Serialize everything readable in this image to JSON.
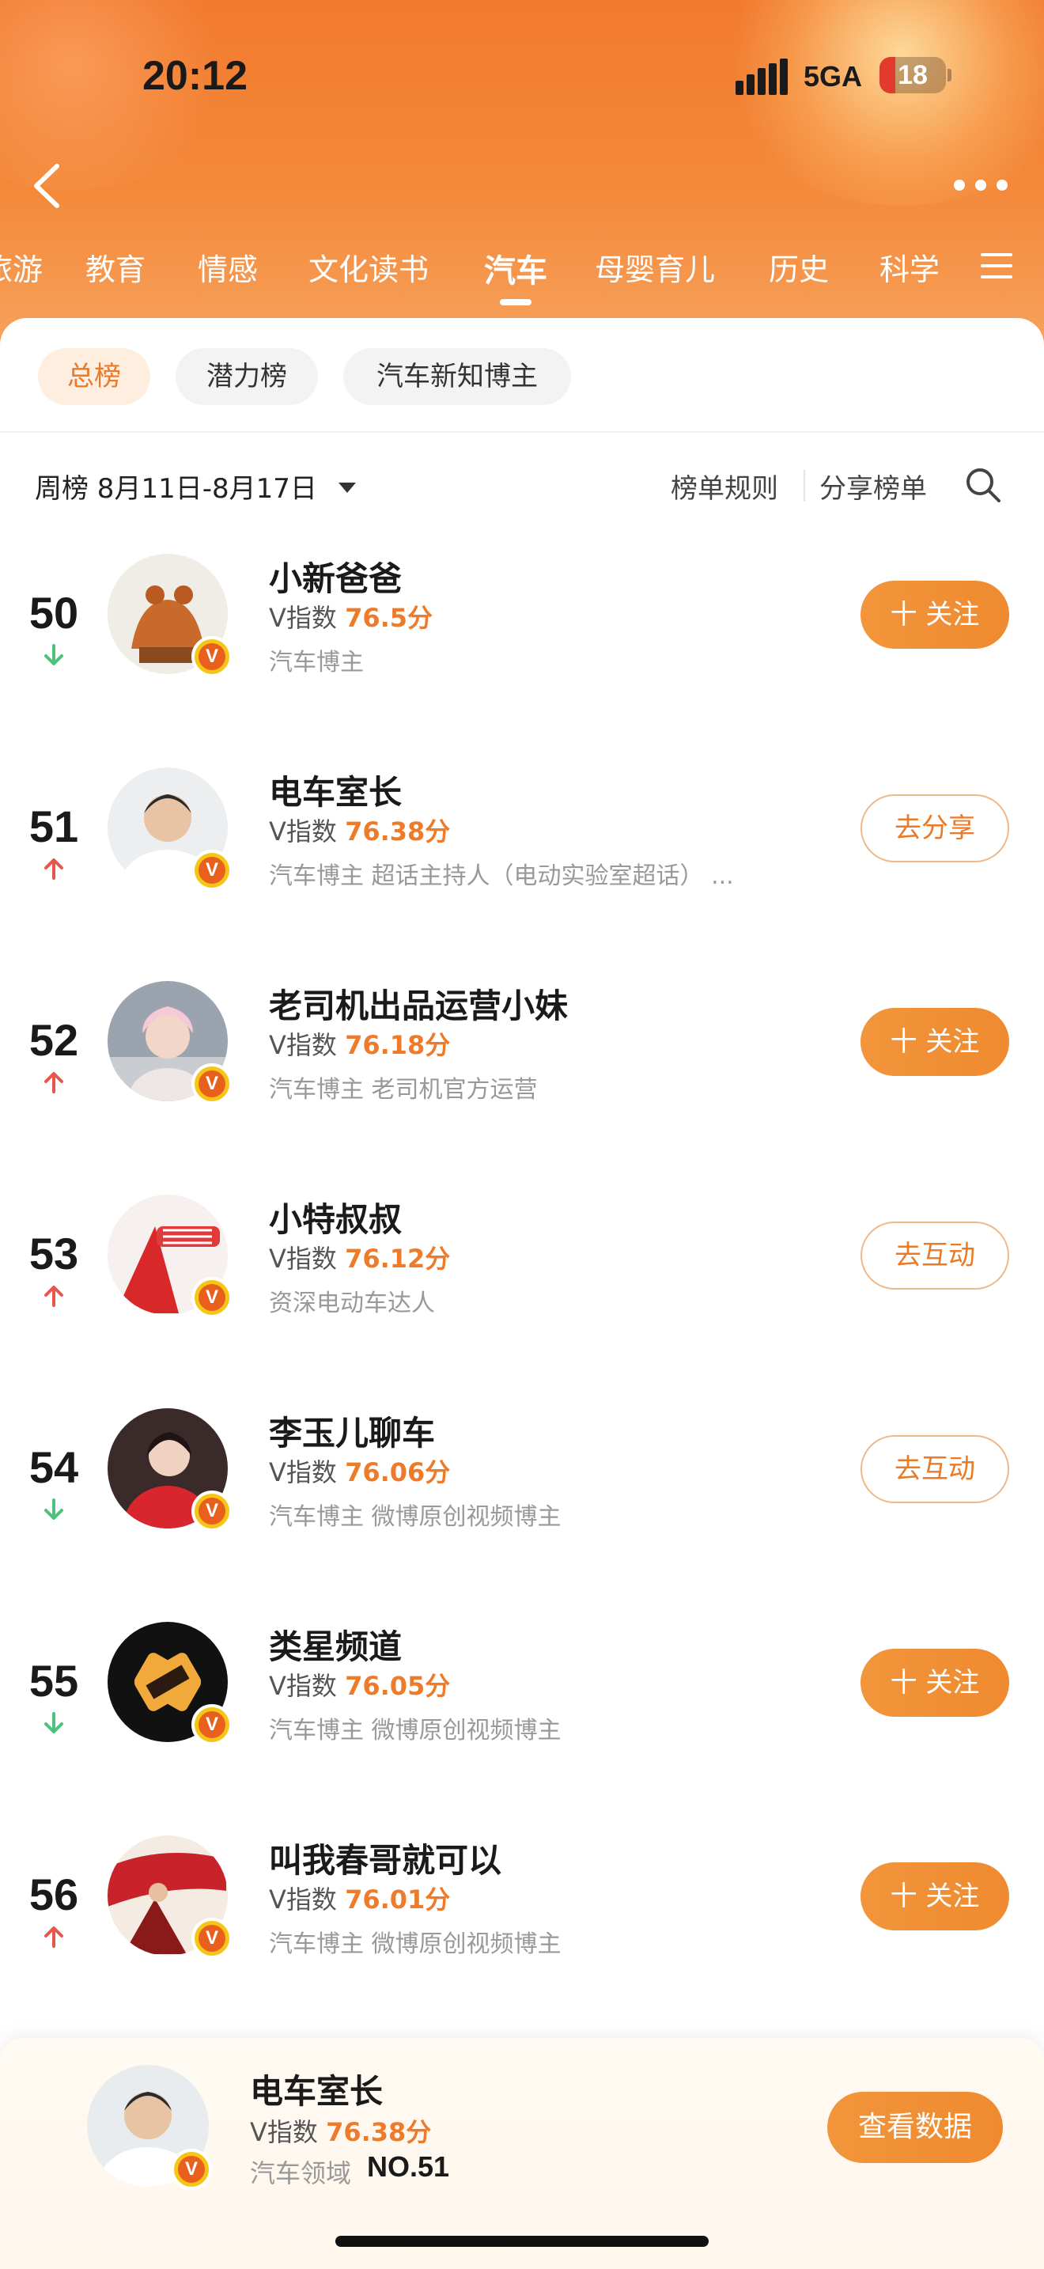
{
  "status_bar": {
    "time": "20:12",
    "network": "5GA",
    "battery": "18"
  },
  "category_tabs": {
    "items": [
      "旅游",
      "教育",
      "情感",
      "文化读书",
      "汽车",
      "母婴育儿",
      "历史",
      "科学"
    ],
    "active": "汽车"
  },
  "sub_tabs": {
    "items": [
      "总榜",
      "潜力榜",
      "汽车新知博主"
    ],
    "active": "总榜"
  },
  "toolbar": {
    "week_label": "周榜 8月11日-8月17日",
    "rules_label": "榜单规则",
    "share_label": "分享榜单"
  },
  "ranking": {
    "vindex_prefix": "V指数",
    "rows": [
      {
        "rank": "50",
        "trend": "down",
        "name": "小新爸爸",
        "score": "76.5分",
        "desc": "汽车博主",
        "action": "十 关注",
        "action_type": "follow"
      },
      {
        "rank": "51",
        "trend": "up",
        "name": "电车室长",
        "score": "76.38分",
        "desc": "汽车博主 超话主持人（电动实验室超话） ...",
        "action": "去分享",
        "action_type": "outline"
      },
      {
        "rank": "52",
        "trend": "up",
        "name": "老司机出品运营小妹",
        "score": "76.18分",
        "desc": "汽车博主 老司机官方运营",
        "action": "十 关注",
        "action_type": "follow"
      },
      {
        "rank": "53",
        "trend": "up",
        "name": "小特叔叔",
        "score": "76.12分",
        "desc": "资深电动车达人",
        "action": "去互动",
        "action_type": "outline"
      },
      {
        "rank": "54",
        "trend": "down",
        "name": "李玉儿聊车",
        "score": "76.06分",
        "desc": "汽车博主 微博原创视频博主",
        "action": "去互动",
        "action_type": "outline"
      },
      {
        "rank": "55",
        "trend": "down",
        "name": "类星频道",
        "score": "76.05分",
        "desc": "汽车博主 微博原创视频博主",
        "action": "十 关注",
        "action_type": "follow"
      },
      {
        "rank": "56",
        "trend": "up",
        "name": "叫我春哥就可以",
        "score": "76.01分",
        "desc": "汽车博主 微博原创视频博主",
        "action": "十 关注",
        "action_type": "follow"
      }
    ]
  },
  "bottom_bar": {
    "name": "电车室长",
    "vindex_prefix": "V指数",
    "score": "76.38分",
    "field": "汽车领域",
    "rank": "NO.51",
    "button": "查看数据"
  },
  "colors": {
    "accent": "#ef8a30",
    "trend_up": "#e8564a",
    "trend_down": "#4cc27a"
  }
}
